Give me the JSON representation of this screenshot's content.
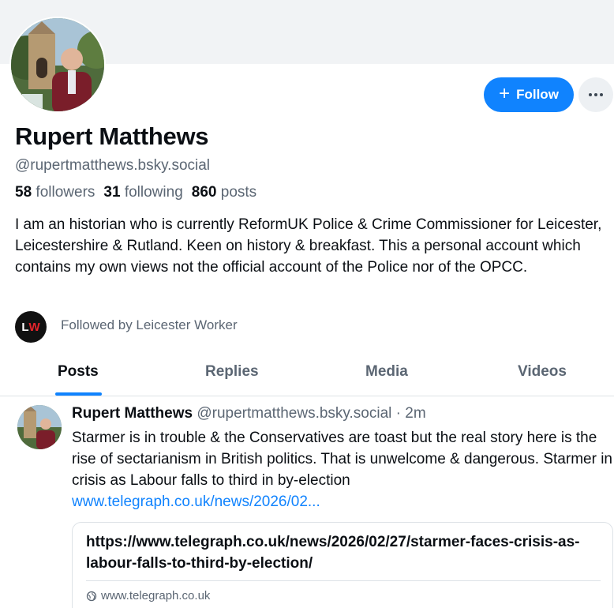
{
  "profile": {
    "display_name": "Rupert Matthews",
    "handle": "@rupertmatthews.bsky.social",
    "followers_count": "58",
    "followers_label": "followers",
    "following_count": "31",
    "following_label": "following",
    "posts_count": "860",
    "posts_label": "posts",
    "bio": "I am an historian who is currently ReformUK Police & Crime Commissioner for Leicester, Leicestershire & Rutland. Keen on history & breakfast. This a personal account which contains my own views not the official account of the Police nor of the OPCC.",
    "followed_by_text": "Followed by Leicester Worker",
    "followed_by_avatar": {
      "letter1": "L",
      "letter2": "W"
    }
  },
  "actions": {
    "follow_label": "Follow",
    "follow_icon": "plus-icon",
    "more_icon": "ellipsis-icon"
  },
  "tabs": [
    {
      "label": "Posts",
      "active": true
    },
    {
      "label": "Replies",
      "active": false
    },
    {
      "label": "Media",
      "active": false
    },
    {
      "label": "Videos",
      "active": false
    }
  ],
  "post": {
    "author_name": "Rupert Matthews",
    "author_handle": "@rupertmatthews.bsky.social",
    "separator": "·",
    "timestamp": "2m",
    "text": "Starmer is in trouble & the Conservatives are toast but the real story here is the rise of sectarianism in British politics. That is unwelcome & dangerous. Starmer in crisis as Labour falls to third in by-election",
    "link_text": "www.telegraph.co.uk/news/2026/02...",
    "embed": {
      "title": "https://www.telegraph.co.uk/news/2026/02/27/starmer-faces-crisis-as-labour-falls-to-third-by-election/",
      "domain": "www.telegraph.co.uk",
      "domain_icon": "globe-icon"
    }
  },
  "colors": {
    "accent": "#1083fe",
    "text_primary": "#0b0f14",
    "text_secondary": "#5b6673",
    "banner": "#f1f3f5",
    "border": "#dde2e7"
  }
}
